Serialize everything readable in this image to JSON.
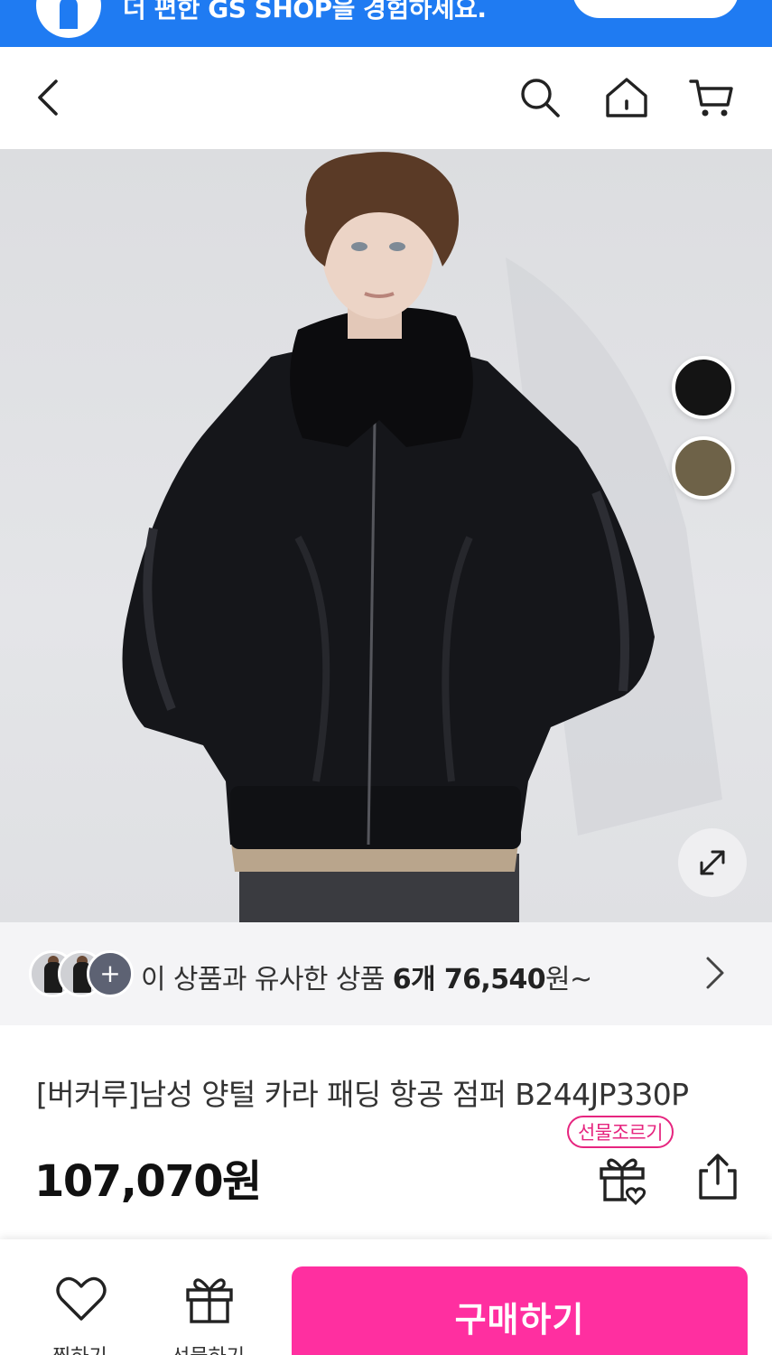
{
  "banner": {
    "text": "더 편한 GS SHOP을 경험하세요."
  },
  "header": {
    "back_icon": "chevron-left-icon",
    "search_icon": "search-icon",
    "home_icon": "home-icon",
    "cart_icon": "cart-icon"
  },
  "product": {
    "color_options": [
      {
        "name": "black",
        "color": "#141414"
      },
      {
        "name": "olive",
        "color": "#6e6248"
      }
    ],
    "title": "[버커루]남성 양털 카라 패딩 항공 점퍼 B244JP330P",
    "price": "107,070원"
  },
  "similar": {
    "prefix": "이 상품과 유사한 상품 ",
    "count": "6개 76,540",
    "suffix": "원~",
    "more_symbol": "+"
  },
  "actions": {
    "gift_badge": "선물조르기",
    "wish_label": "찜하기",
    "gift_label": "선물하기",
    "buy_label": "구매하기"
  },
  "colors": {
    "banner": "#1f7bf2",
    "accent": "#ff2fa0",
    "badge": "#e6257f"
  }
}
